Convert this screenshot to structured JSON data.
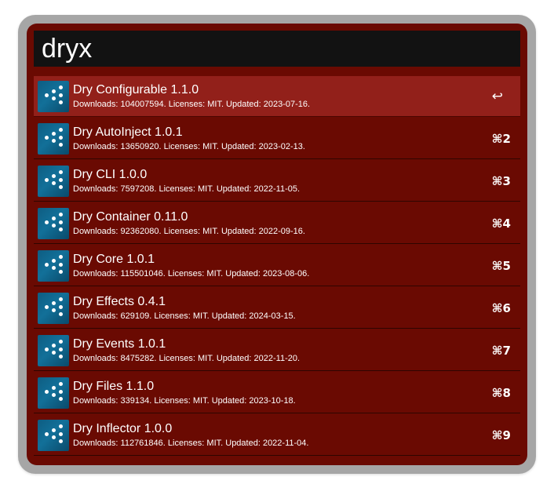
{
  "search": {
    "query": "dryx"
  },
  "results": [
    {
      "title": "Dry Configurable 1.1.0",
      "subtitle": "Downloads: 104007594. Licenses: MIT. Updated: 2023-07-16.",
      "shortcut": "↩",
      "icon": "dry-rb-logo-icon",
      "selected": true
    },
    {
      "title": "Dry AutoInject 1.0.1",
      "subtitle": "Downloads: 13650920. Licenses: MIT. Updated: 2023-02-13.",
      "shortcut": "⌘2",
      "icon": "dry-rb-logo-icon"
    },
    {
      "title": "Dry CLI 1.0.0",
      "subtitle": "Downloads: 7597208. Licenses: MIT. Updated: 2022-11-05.",
      "shortcut": "⌘3",
      "icon": "dry-rb-logo-icon"
    },
    {
      "title": "Dry Container 0.11.0",
      "subtitle": "Downloads: 92362080. Licenses: MIT. Updated: 2022-09-16.",
      "shortcut": "⌘4",
      "icon": "dry-rb-logo-icon"
    },
    {
      "title": "Dry Core 1.0.1",
      "subtitle": "Downloads: 115501046. Licenses: MIT. Updated: 2023-08-06.",
      "shortcut": "⌘5",
      "icon": "dry-rb-logo-icon"
    },
    {
      "title": "Dry Effects 0.4.1",
      "subtitle": "Downloads: 629109. Licenses: MIT. Updated: 2024-03-15.",
      "shortcut": "⌘6",
      "icon": "dry-rb-logo-icon"
    },
    {
      "title": "Dry Events 1.0.1",
      "subtitle": "Downloads: 8475282. Licenses: MIT. Updated: 2022-11-20.",
      "shortcut": "⌘7",
      "icon": "dry-rb-logo-icon"
    },
    {
      "title": "Dry Files 1.1.0",
      "subtitle": "Downloads: 339134. Licenses: MIT. Updated: 2023-10-18.",
      "shortcut": "⌘8",
      "icon": "dry-rb-logo-icon"
    },
    {
      "title": "Dry Inflector 1.0.0",
      "subtitle": "Downloads: 112761846. Licenses: MIT. Updated: 2022-11-04.",
      "shortcut": "⌘9",
      "icon": "dry-rb-logo-icon"
    }
  ],
  "colors": {
    "panel_background": "#6a0a02",
    "selected_row": "#92201a",
    "search_field": "#121212",
    "frame": "#a6a6a6"
  }
}
